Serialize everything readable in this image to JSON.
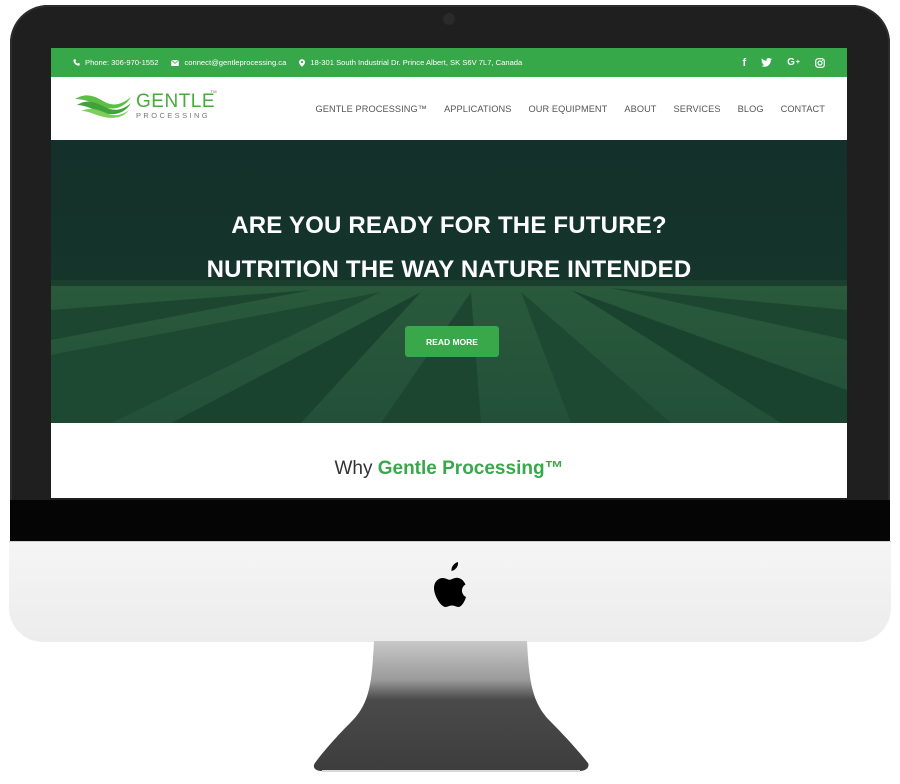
{
  "topbar": {
    "phone": "Phone: 306-970-1552",
    "email": "connect@gentleprocessing.ca",
    "address": "18-301 South Industrial Dr. Prince Albert, SK S6V 7L7, Canada",
    "social": [
      {
        "name": "facebook",
        "glyph": "f"
      },
      {
        "name": "twitter",
        "glyph": "twitter"
      },
      {
        "name": "google-plus",
        "glyph": "G+"
      },
      {
        "name": "instagram",
        "glyph": "instagram"
      }
    ]
  },
  "logo": {
    "main": "GENTLE",
    "tm": "TM",
    "sub": "PROCESSING"
  },
  "nav": {
    "items": [
      "GENTLE PROCESSING™",
      "APPLICATIONS",
      "OUR EQUIPMENT",
      "ABOUT",
      "SERVICES",
      "BLOG",
      "CONTACT"
    ]
  },
  "hero": {
    "title_line1": "ARE YOU READY FOR THE FUTURE?",
    "title_line2": "NUTRITION THE WAY NATURE INTENDED",
    "button": "READ MORE"
  },
  "section": {
    "why_prefix": "Why ",
    "why_highlight": "Gentle Processing™"
  },
  "colors": {
    "brand_green": "#38a84b",
    "hero_dark": "#143126"
  }
}
